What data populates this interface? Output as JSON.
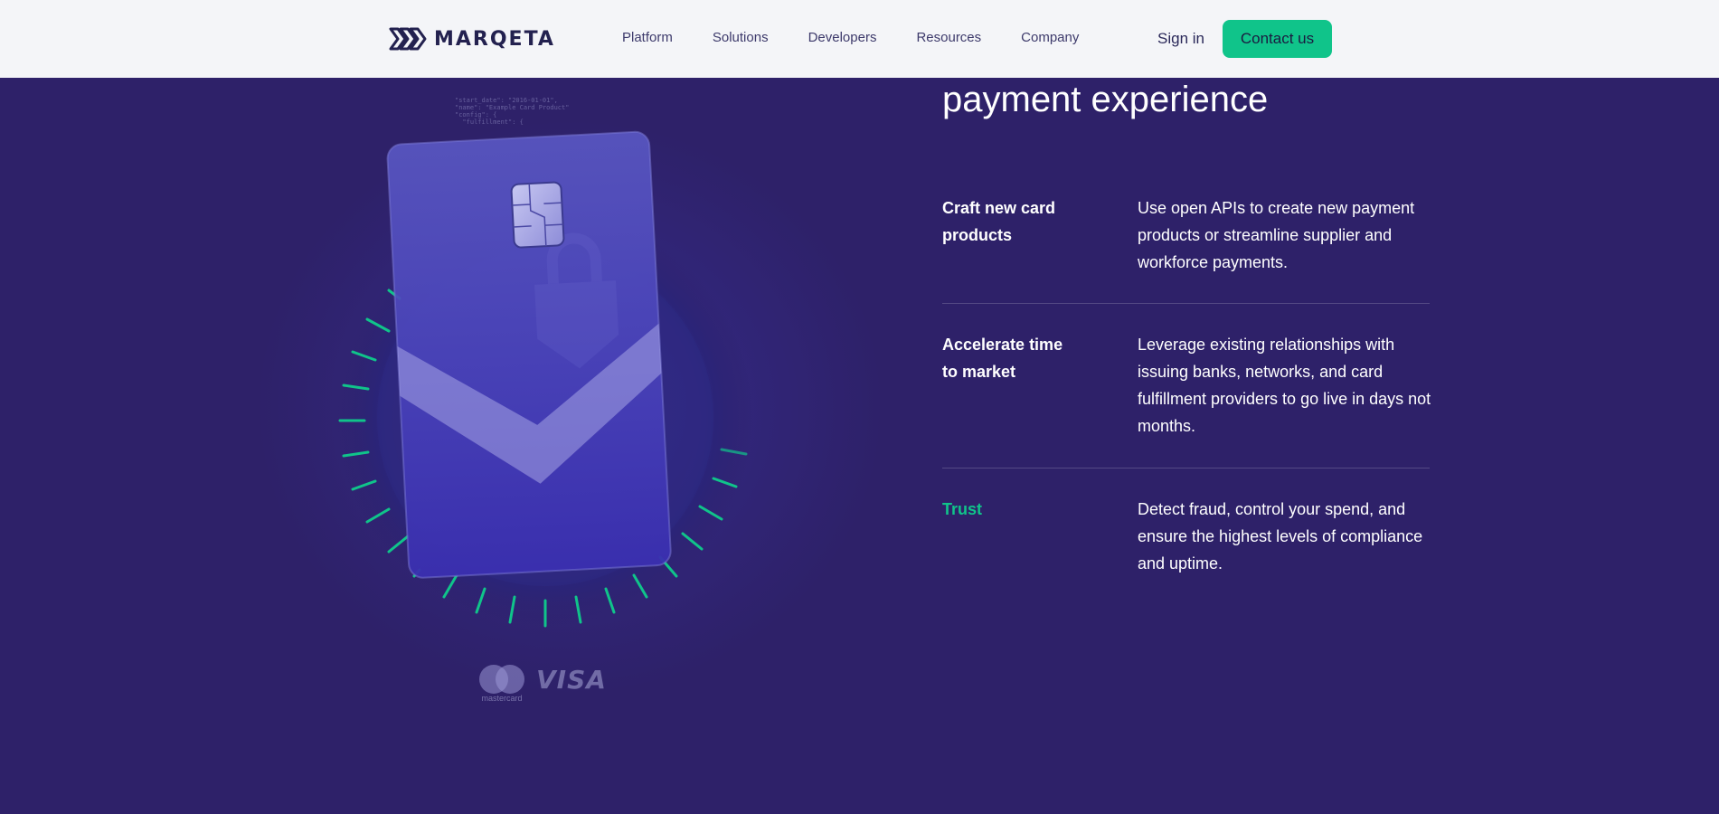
{
  "header": {
    "logo_text": "MARQETA",
    "nav": [
      "Platform",
      "Solutions",
      "Developers",
      "Resources",
      "Company"
    ],
    "sign_in": "Sign in",
    "contact": "Contact us"
  },
  "hero": {
    "heading": "payment experience",
    "features": [
      {
        "title": "Craft new card products",
        "description": "Use open APIs to create new payment products or streamline supplier and workforce payments."
      },
      {
        "title": "Accelerate time to market",
        "description": "Leverage existing relationships with issuing banks, networks, and card fulfillment providers to go live in days not months."
      },
      {
        "title": "Trust",
        "description": "Detect fraud, control your spend, and ensure the highest levels of compliance and uptime."
      }
    ]
  },
  "illustration": {
    "code_snippet": "\"start_date\": \"2016-01-01\",\n\"name\": \"Example Card Product\"\n\"config\": {\n  \"fulfillment\": {",
    "networks": {
      "mastercard": "mastercard",
      "visa": "VISA"
    }
  },
  "colors": {
    "background": "#2e2169",
    "header_bg": "#f4f5f8",
    "accent": "#10c48a",
    "logo": "#23214f"
  }
}
